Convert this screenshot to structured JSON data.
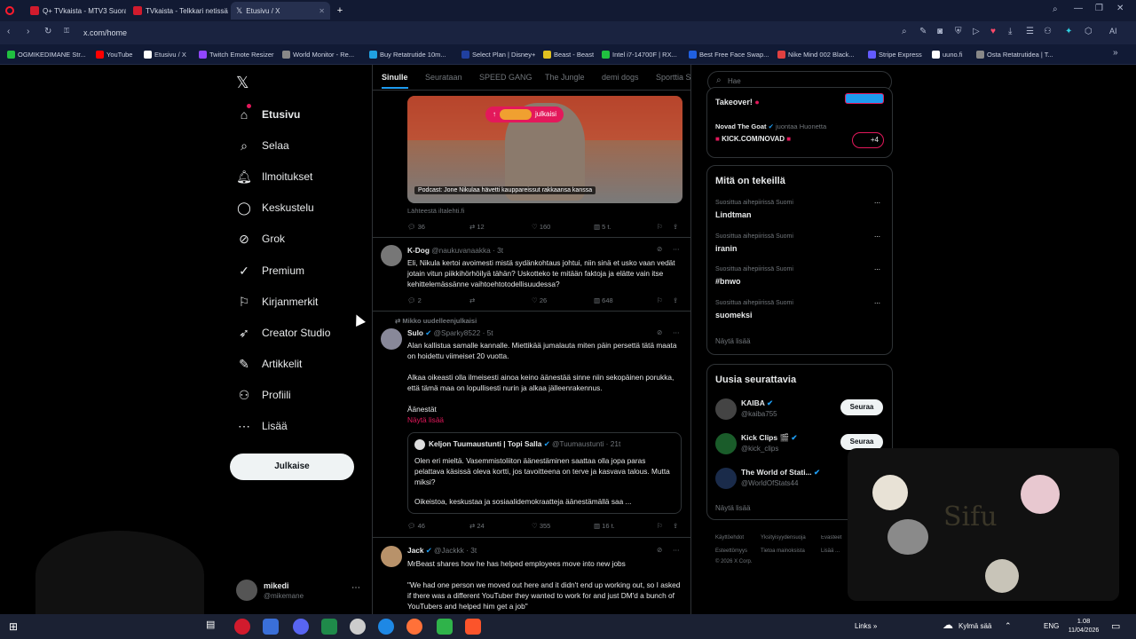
{
  "browser": {
    "tabs": [
      {
        "label": "Q+ TVkaista - MTV3 Suora",
        "color": "#d11b2d"
      },
      {
        "label": "TVkaista - Telkkari netissä",
        "color": "#d11b2d"
      },
      {
        "label": "Etusivu / X",
        "color": "#ffffff"
      }
    ],
    "url": "x.com/home",
    "bookmarks": [
      {
        "label": "OGMIKEDIMANE Str...",
        "color": "#20c040"
      },
      {
        "label": "YouTube",
        "color": "#ff0000"
      },
      {
        "label": "Etusivu / X",
        "color": "#ffffff"
      },
      {
        "label": "Twitch Emote Resizer",
        "color": "#9146ff"
      },
      {
        "label": "World Monitor - Re...",
        "color": "#888888"
      },
      {
        "label": "Buy Retatrutide 10m...",
        "color": "#20a0e0"
      },
      {
        "label": "Select Plan | Disney+",
        "color": "#2040a0"
      },
      {
        "label": "Beast - Beast",
        "color": "#e0c020"
      },
      {
        "label": "Intel i7-14700F | RX...",
        "color": "#20c040"
      },
      {
        "label": "Best Free Face Swap...",
        "color": "#2060e0"
      },
      {
        "label": "Nike Mind 002 Black...",
        "color": "#e04040"
      },
      {
        "label": "Stripe Express",
        "color": "#635bff"
      },
      {
        "label": "uuno.fi",
        "color": "#ffffff"
      },
      {
        "label": "Osta Retatrutidea | T...",
        "color": "#888888"
      }
    ]
  },
  "sidebar": {
    "items": [
      {
        "label": "Etusivu",
        "icon": "home-icon"
      },
      {
        "label": "Selaa",
        "icon": "search-icon"
      },
      {
        "label": "Ilmoitukset",
        "icon": "bell-icon"
      },
      {
        "label": "Keskustelu",
        "icon": "chat-icon"
      },
      {
        "label": "Grok",
        "icon": "grok-icon"
      },
      {
        "label": "Premium",
        "icon": "premium-icon"
      },
      {
        "label": "Kirjanmerkit",
        "icon": "bookmark-icon"
      },
      {
        "label": "Creator Studio",
        "icon": "rocket-icon"
      },
      {
        "label": "Artikkelit",
        "icon": "article-icon"
      },
      {
        "label": "Profiili",
        "icon": "profile-icon"
      },
      {
        "label": "Lisää",
        "icon": "more-icon"
      }
    ],
    "post_button": "Julkaise",
    "account": {
      "name": "mikedi",
      "handle": "@mikemane"
    }
  },
  "feed": {
    "tabs": [
      "Sinulle",
      "Seurataan",
      "SPEED GANG",
      "The Jungle",
      "demi dogs",
      "Sporttia S"
    ],
    "new_posts_pill": "julkaisi",
    "post1": {
      "caption": "Podcast: Jone Nikulaa hävetti kauppareissut rakkaansa kanssa",
      "source": "Lähteestä iltalehti.fi",
      "replies": "36",
      "reposts": "12",
      "likes": "160",
      "views": "5 t."
    },
    "post2": {
      "name": "K-Dog",
      "handle": "@naukuvanaakka · 3t",
      "text": "Eli, Nikula kertoi avoimesti mistä sydänkohtaus johtui, niin sinä et usko vaan vedät jotain vitun piikkihörhöilyä tähän? Uskotteko te mitään faktoja ja elätte vain itse kehittelemässänne vaihtoehtotodellisuudessa?",
      "replies": "2",
      "reposts": "",
      "likes": "26",
      "views": "648"
    },
    "post3": {
      "repost_label": "Mikko uudelleenjulkaisi",
      "name": "Sulo",
      "handle": "@Sparky8522 · 5t",
      "text1": "Alan kallistua samalle kannalle. Miettikää jumalauta miten päin persettä tätä maata on hoidettu viimeiset 20 vuotta.",
      "text2": "Alkaa oikeasti olla ilmeisesti ainoa keino äänestää sinne niin sekopäinen porukka, että tämä maa on lopullisesti nurin ja alkaa jälleenrakennus.",
      "text3": "Äänestät",
      "show_more": "Näytä lisää",
      "quote_name": "Keljon Tuumaustunti | Topi Salla",
      "quote_handle": "@Tuumaustunti · 21t",
      "quote_text1": "Olen eri mieltä. Vasemmistoliiton äänestäminen saattaa olla jopa paras pelattava käsissä oleva kortti, jos tavoitteena on terve ja kasvava talous. Mutta miksi?",
      "quote_text2": "Oikeistoa, keskustaa ja sosiaalidemokraatteja äänestämällä saa ...",
      "replies": "46",
      "reposts": "24",
      "likes": "355",
      "views": "16 t."
    },
    "post4": {
      "name": "Jack",
      "handle": "@Jackkk · 3t",
      "text1": "MrBeast shares how he has helped employees move into new jobs",
      "text2": "\"We had one person we moved out here and it didn't end up working out, so I asked if there was a different YouTuber they wanted to work for and just DM'd a bunch of YouTubers and helped him get a job\""
    }
  },
  "right": {
    "search_placeholder": "Hae",
    "live": {
      "title": "Takeover!",
      "user": "Novad The Goat",
      "action": "juontaa Huonetta",
      "room": "KICK.COM/NOVAD",
      "extra": "+4"
    },
    "trends_title": "Mitä on tekeillä",
    "trends": [
      {
        "context": "Suosittua aihepiirissä Suomi",
        "name": "Lindtman"
      },
      {
        "context": "Suosittua aihepiirissä Suomi",
        "name": "iranin"
      },
      {
        "context": "Suosittua aihepiirissä Suomi",
        "name": "#bnwo"
      },
      {
        "context": "Suosittua aihepiirissä Suomi",
        "name": "suomeksi"
      }
    ],
    "show_more": "Näytä lisää",
    "who_title": "Uusia seurattavia",
    "who": [
      {
        "name": "KAIBA",
        "handle": "@kaiba755"
      },
      {
        "name": "Kick Clips 🎬",
        "handle": "@kick_clips"
      },
      {
        "name": "The World of Stati...",
        "handle": "@WorldOfStats44"
      }
    ],
    "follow_label": "Seuraa",
    "footer": [
      "Käyttöehdot",
      "Yksityisyydensuoja",
      "Evästeet",
      "Esteettömyys",
      "Tietoa mainoksista",
      "Lisää ...",
      "© 2026 X Corp."
    ]
  },
  "taskbar": {
    "links": "Links",
    "weather": "Kylmä sää",
    "lang": "ENG",
    "time": "1.08",
    "date": "11/04/2026"
  }
}
